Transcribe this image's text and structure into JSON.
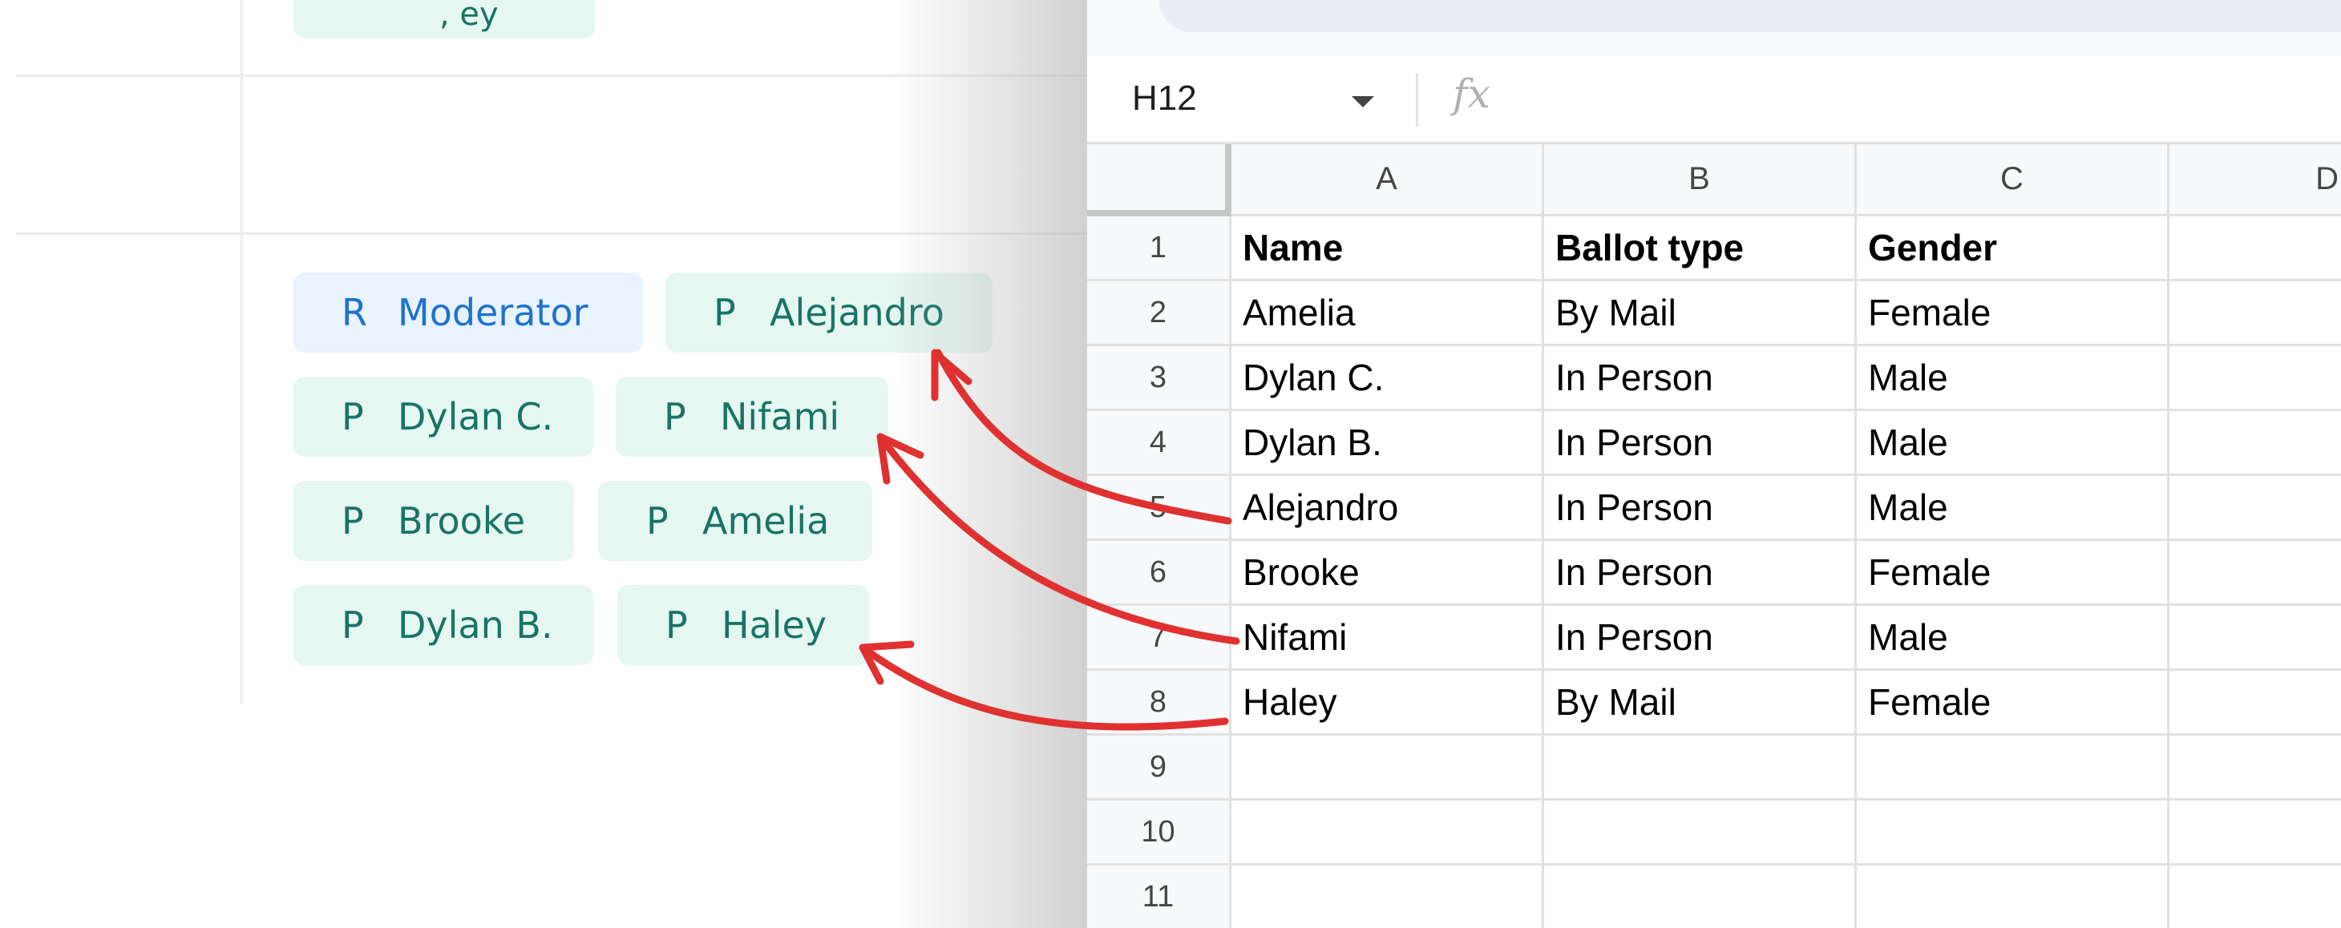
{
  "participants": {
    "top_chip_fragment": ", ey",
    "chips": [
      {
        "letter": "R",
        "label": "Moderator",
        "kind": "role"
      },
      {
        "letter": "P",
        "label": "Alejandro",
        "kind": "participant"
      },
      {
        "letter": "P",
        "label": "Dylan C.",
        "kind": "participant"
      },
      {
        "letter": "P",
        "label": "Nifami",
        "kind": "participant"
      },
      {
        "letter": "P",
        "label": "Brooke",
        "kind": "participant"
      },
      {
        "letter": "P",
        "label": "Amelia",
        "kind": "participant"
      },
      {
        "letter": "P",
        "label": "Dylan B.",
        "kind": "participant"
      },
      {
        "letter": "P",
        "label": "Haley",
        "kind": "participant"
      }
    ]
  },
  "sheet": {
    "name_box": "H12",
    "fx_icon": "fx-icon",
    "columns": [
      "A",
      "B",
      "C",
      "D"
    ],
    "row_numbers": [
      "1",
      "2",
      "3",
      "4",
      "5",
      "6",
      "7",
      "8",
      "9",
      "10",
      "11"
    ],
    "rows": [
      [
        "Name",
        "Ballot type",
        "Gender"
      ],
      [
        "Amelia",
        "By Mail",
        "Female"
      ],
      [
        "Dylan C.",
        "In Person",
        "Male"
      ],
      [
        "Dylan B.",
        "In Person",
        "Male"
      ],
      [
        "Alejandro",
        "In Person",
        "Male"
      ],
      [
        "Brooke",
        "In Person",
        "Female"
      ],
      [
        "Nifami",
        "In Person",
        "Male"
      ],
      [
        "Haley",
        "By Mail",
        "Female"
      ],
      [
        "",
        "",
        ""
      ],
      [
        "",
        "",
        ""
      ],
      [
        "",
        "",
        ""
      ]
    ]
  },
  "annotations": {
    "arrow_color": "#e03131",
    "arrows": [
      {
        "from_row_name": "Alejandro",
        "to_chip": "Alejandro"
      },
      {
        "from_row_name": "Nifami",
        "to_chip": "Nifami"
      },
      {
        "from_row_name": "Haley",
        "to_chip": "Haley"
      }
    ]
  },
  "colors": {
    "participant_chip_bg": "#e6f6f1",
    "participant_chip_text": "#177564",
    "role_chip_bg": "#e8f3fe",
    "role_chip_text": "#1d72cf"
  }
}
